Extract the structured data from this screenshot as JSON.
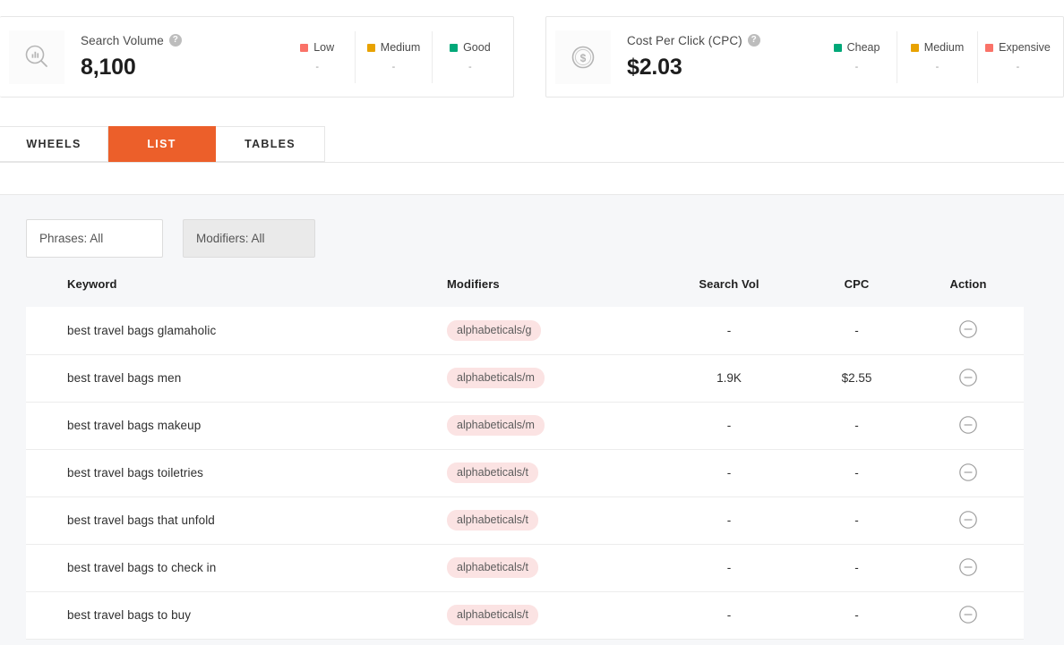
{
  "metrics": [
    {
      "id": "search-volume",
      "icon": "magnifier-bar-chart-icon",
      "label": "Search Volume",
      "help": "?",
      "value": "8,100",
      "legend": [
        {
          "label": "Low",
          "color": "#fa7268",
          "value": "-"
        },
        {
          "label": "Medium",
          "color": "#e8a200",
          "value": "-"
        },
        {
          "label": "Good",
          "color": "#00a878",
          "value": "-"
        }
      ]
    },
    {
      "id": "cost-per-click",
      "icon": "dollar-coin-icon",
      "label": "Cost Per Click (CPC)",
      "help": "?",
      "value": "$2.03",
      "legend": [
        {
          "label": "Cheap",
          "color": "#00a878",
          "value": "-"
        },
        {
          "label": "Medium",
          "color": "#e8a200",
          "value": "-"
        },
        {
          "label": "Expensive",
          "color": "#fa7268",
          "value": "-"
        }
      ]
    }
  ],
  "tabs": [
    {
      "id": "wheels",
      "label": "WHEELS",
      "active": false
    },
    {
      "id": "list",
      "label": "LIST",
      "active": true
    },
    {
      "id": "tables",
      "label": "TABLES",
      "active": false
    }
  ],
  "filters": [
    {
      "id": "phrases",
      "label": "Phrases: All",
      "style": "light"
    },
    {
      "id": "modifiers",
      "label": "Modifiers: All",
      "style": "grey"
    }
  ],
  "table": {
    "columns": {
      "keyword": "Keyword",
      "modifiers": "Modifiers",
      "search_vol": "Search Vol",
      "cpc": "CPC",
      "action": "Action"
    },
    "rows": [
      {
        "keyword": "best travel bags glamaholic",
        "modifier": "alphabeticals/g",
        "search_vol": "-",
        "cpc": "-",
        "action_icon": "remove-circle-icon"
      },
      {
        "keyword": "best travel bags men",
        "modifier": "alphabeticals/m",
        "search_vol": "1.9K",
        "cpc": "$2.55",
        "action_icon": "remove-circle-icon"
      },
      {
        "keyword": "best travel bags makeup",
        "modifier": "alphabeticals/m",
        "search_vol": "-",
        "cpc": "-",
        "action_icon": "remove-circle-icon"
      },
      {
        "keyword": "best travel bags toiletries",
        "modifier": "alphabeticals/t",
        "search_vol": "-",
        "cpc": "-",
        "action_icon": "remove-circle-icon"
      },
      {
        "keyword": "best travel bags that unfold",
        "modifier": "alphabeticals/t",
        "search_vol": "-",
        "cpc": "-",
        "action_icon": "remove-circle-icon"
      },
      {
        "keyword": "best travel bags to check in",
        "modifier": "alphabeticals/t",
        "search_vol": "-",
        "cpc": "-",
        "action_icon": "remove-circle-icon"
      },
      {
        "keyword": "best travel bags to buy",
        "modifier": "alphabeticals/t",
        "search_vol": "-",
        "cpc": "-",
        "action_icon": "remove-circle-icon"
      }
    ]
  },
  "theme": {
    "accent": "#ec5f2a",
    "pill_bg": "#fbe3e3",
    "page_bg": "#f6f7f9"
  }
}
